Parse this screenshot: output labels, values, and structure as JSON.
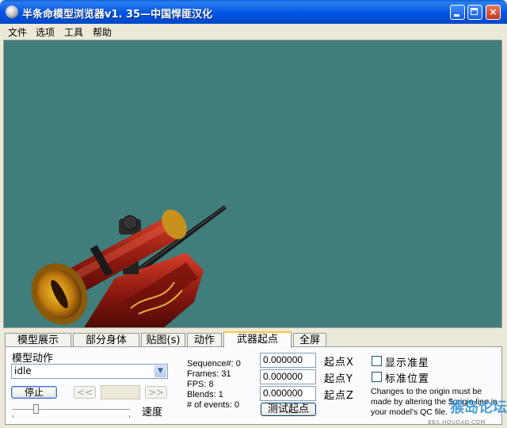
{
  "window": {
    "title": "半条命模型浏览器v1. 35—中国悍匪汉化",
    "minimize_label": "",
    "maximize_label": "",
    "close_label": "×"
  },
  "menu": [
    "文件",
    "选项",
    "工具",
    "帮助"
  ],
  "viewport": {
    "background_color": "#3f7e7b"
  },
  "tabs": [
    {
      "label": "模型展示",
      "active": false
    },
    {
      "label": "部分身体",
      "active": false
    },
    {
      "label": "贴图(s)",
      "active": false
    },
    {
      "label": "动作",
      "active": false
    },
    {
      "label": "武器起点",
      "active": true
    },
    {
      "label": "全屏",
      "active": false
    }
  ],
  "animation": {
    "label": "模型动作",
    "selected": "idle",
    "stop_button": "停止",
    "prev_button": "<<",
    "next_button": ">>",
    "speed_label": "速度",
    "speed_level": 0.2
  },
  "stats": {
    "sequence": "Sequence#: 0",
    "frames": "Frames: 31",
    "fps": "FPS: 8",
    "blends": "Blends: 1",
    "events": "# of events: 0"
  },
  "origin": {
    "x_value": "0.000000",
    "y_value": "0.000000",
    "z_value": "0.000000",
    "x_label": "起点X",
    "y_label": "起点Y",
    "z_label": "起点Z",
    "test_button": "测试起点"
  },
  "options": {
    "show_crosshair": {
      "label": "显示准星",
      "checked": false
    },
    "guide_position": {
      "label": "标准位置",
      "checked": false
    }
  },
  "note": "Changes to the origin must be made by altering the $origin line in your model's QC file.",
  "watermark": {
    "logo": "猴岛论坛",
    "url": "BBS.HOUDAO.COM"
  }
}
